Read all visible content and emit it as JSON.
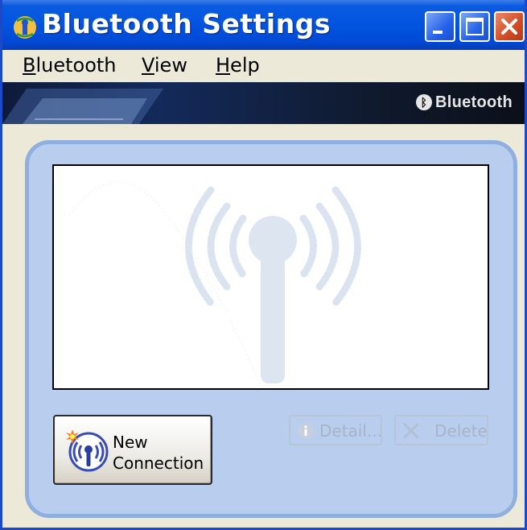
{
  "window": {
    "title": "Bluetooth Settings",
    "controls": [
      "minimize",
      "maximize",
      "close"
    ]
  },
  "menu": [
    {
      "label": "Bluetooth",
      "accel": "B",
      "rest": "luetooth"
    },
    {
      "label": "View",
      "accel": "V",
      "rest": "iew"
    },
    {
      "label": "Help",
      "accel": "H",
      "rest": "elp"
    }
  ],
  "banner": {
    "brand": "Bluetooth",
    "icon": "bluetooth-logo-icon"
  },
  "device_list": {
    "items": [],
    "watermark_icon": "bluetooth-antenna-icon"
  },
  "buttons": {
    "new_connection": {
      "line1": "New",
      "line2": "Connection",
      "icon": "new-connection-antenna-icon"
    },
    "detail": {
      "label": "Detail...",
      "icon": "info-icon",
      "enabled": false
    },
    "delete": {
      "label": "Delete",
      "icon": "delete-x-icon",
      "enabled": false
    }
  },
  "colors": {
    "titlebar": "#0054e3",
    "panel": "#b9cdef",
    "panel_border": "#8fb0df",
    "close": "#d14b24"
  }
}
